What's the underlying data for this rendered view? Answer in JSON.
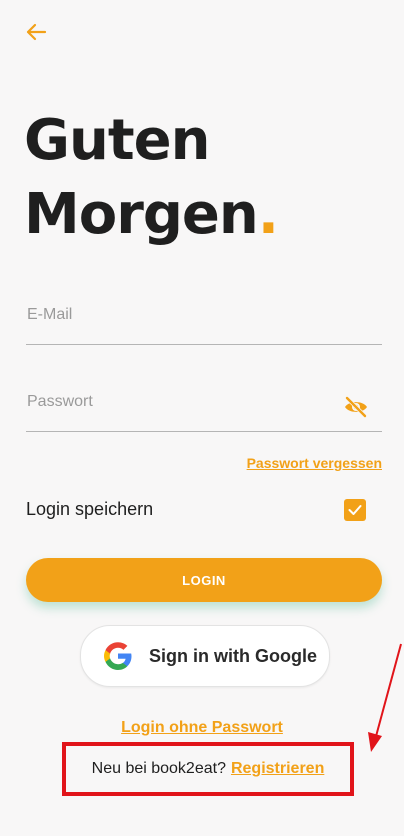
{
  "header": {
    "back_icon": "arrow-left-icon"
  },
  "greeting": {
    "line1": "Guten",
    "line2": "Morgen",
    "dot": "."
  },
  "form": {
    "email_placeholder": "E-Mail",
    "password_placeholder": "Passwort",
    "eye_icon": "eye-off-icon",
    "forgot_password": "Passwort vergessen",
    "remember_label": "Login speichern",
    "remember_checked": true,
    "login_button": "LOGIN"
  },
  "google": {
    "label": "Sign in with Google",
    "icon": "google-g-icon"
  },
  "footer": {
    "passwordless_link": "Login ohne Passwort",
    "register_question": "Neu bei book2eat?",
    "register_link": "Registrieren"
  },
  "colors": {
    "accent": "#f2a118",
    "background": "#f8f7f7",
    "annotation": "#e1141a",
    "text": "#1f1f1f"
  }
}
